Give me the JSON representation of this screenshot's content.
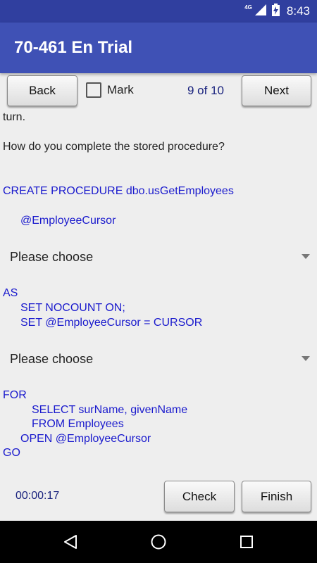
{
  "status_bar": {
    "network": "4G",
    "time": "8:43",
    "icons": [
      "signal-icon",
      "battery-charging-icon"
    ]
  },
  "app_bar": {
    "title": "70-461 En Trial"
  },
  "toolbar": {
    "back_label": "Back",
    "mark_label": "Mark",
    "counter": "9 of 10",
    "next_label": "Next"
  },
  "question": {
    "intro_tail": "turn.",
    "prompt": "How do you complete the stored procedure?",
    "code_line_1": "CREATE PROCEDURE dbo.usGetEmployees",
    "code_line_2": "@EmployeeCursor",
    "dropdown_1": "Please choose",
    "code_line_3": "AS",
    "code_line_4": "SET NOCOUNT ON;",
    "code_line_5": "SET @EmployeeCursor = CURSOR",
    "dropdown_2": "Please choose",
    "code_line_6": "FOR",
    "code_line_7": "SELECT surName, givenName",
    "code_line_8": "FROM Employees",
    "code_line_9": "OPEN @EmployeeCursor",
    "code_line_10": "GO"
  },
  "footer": {
    "timer": "00:00:17",
    "check_label": "Check",
    "finish_label": "Finish"
  },
  "nav_bar": {
    "icons": [
      "back-triangle-icon",
      "home-circle-icon",
      "recents-square-icon"
    ]
  },
  "colors": {
    "status_bar": "#303f9f",
    "app_bar": "#3f51b5",
    "code_text": "#1a1acd",
    "counter_text": "#1a237e",
    "background": "#eeeeee"
  }
}
